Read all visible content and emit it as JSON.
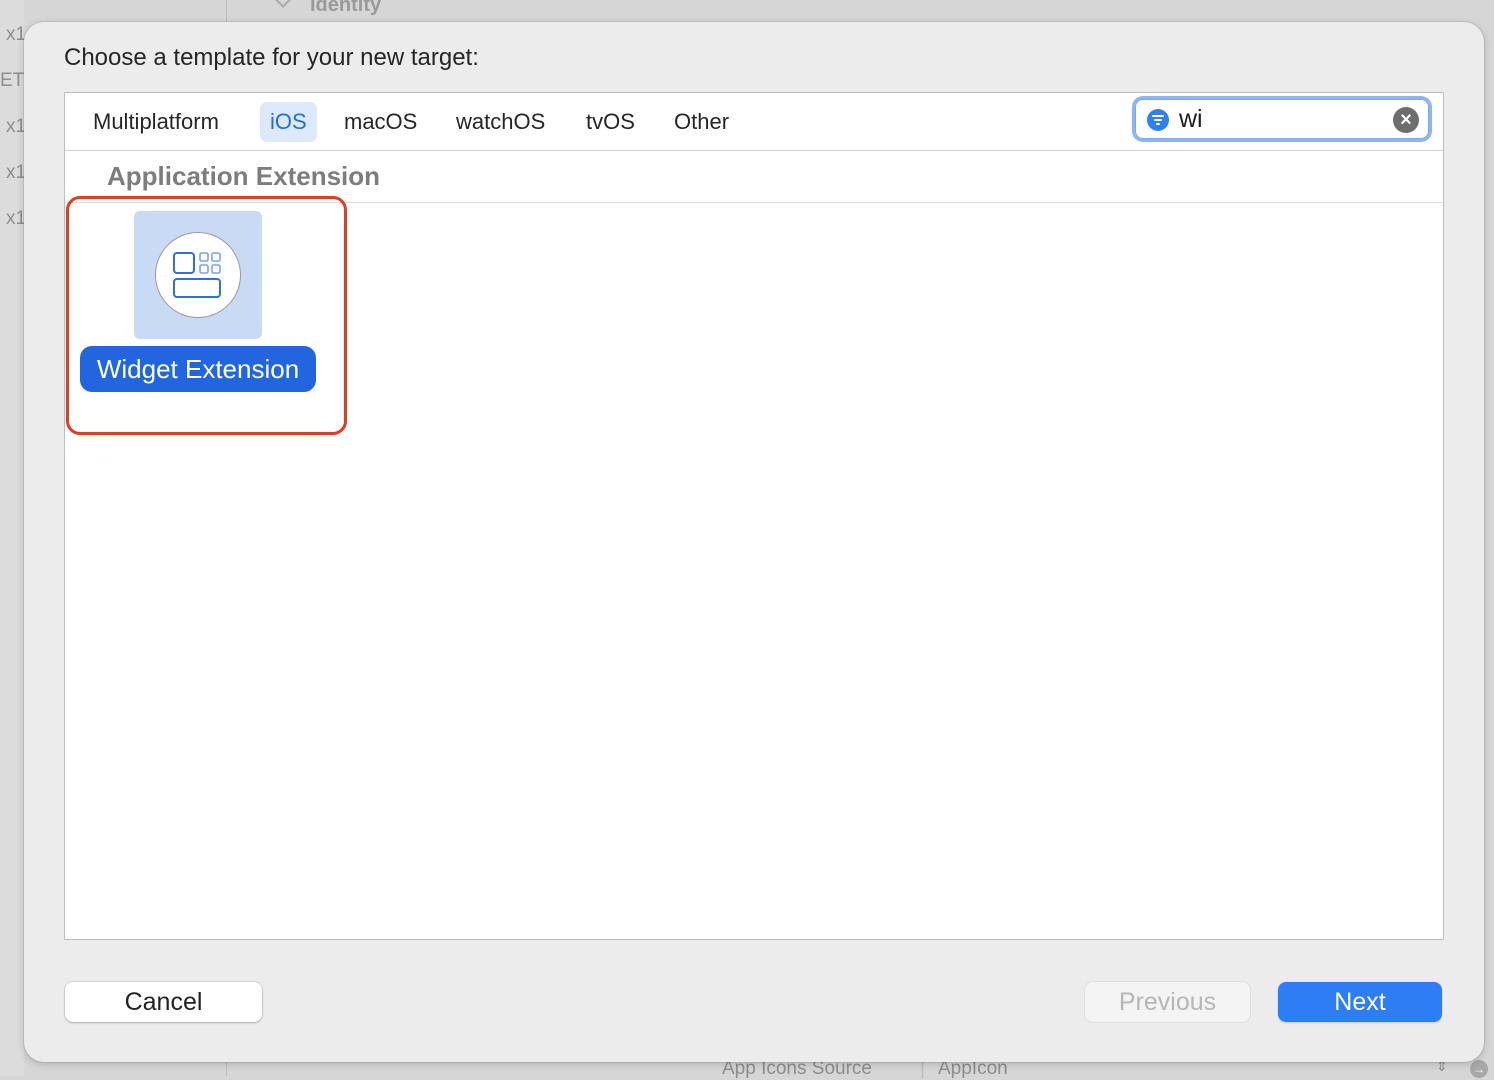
{
  "background": {
    "sidebar_items": [
      "x1",
      "ET",
      "x1",
      "x1",
      "x1"
    ],
    "inspector_heading": "Identity",
    "app_icons_label": "App Icons Source",
    "app_icons_value": "AppIcon"
  },
  "dialog": {
    "title": "Choose a template for your new target:"
  },
  "tabs": [
    {
      "label": "Multiplatform",
      "active": false
    },
    {
      "label": "iOS",
      "active": true
    },
    {
      "label": "macOS",
      "active": false
    },
    {
      "label": "watchOS",
      "active": false
    },
    {
      "label": "tvOS",
      "active": false
    },
    {
      "label": "Other",
      "active": false
    }
  ],
  "search": {
    "value": "wi",
    "filter_icon": "filter-icon",
    "clear_icon": "clear-icon"
  },
  "section": {
    "title": "Application Extension"
  },
  "templates": [
    {
      "label": "Widget Extension",
      "icon": "widget-icon",
      "selected": true
    }
  ],
  "buttons": {
    "cancel": "Cancel",
    "previous": "Previous",
    "next": "Next"
  },
  "colors": {
    "accent": "#2d7ef4",
    "selection": "#2166de",
    "highlight_border": "#e23c25"
  }
}
